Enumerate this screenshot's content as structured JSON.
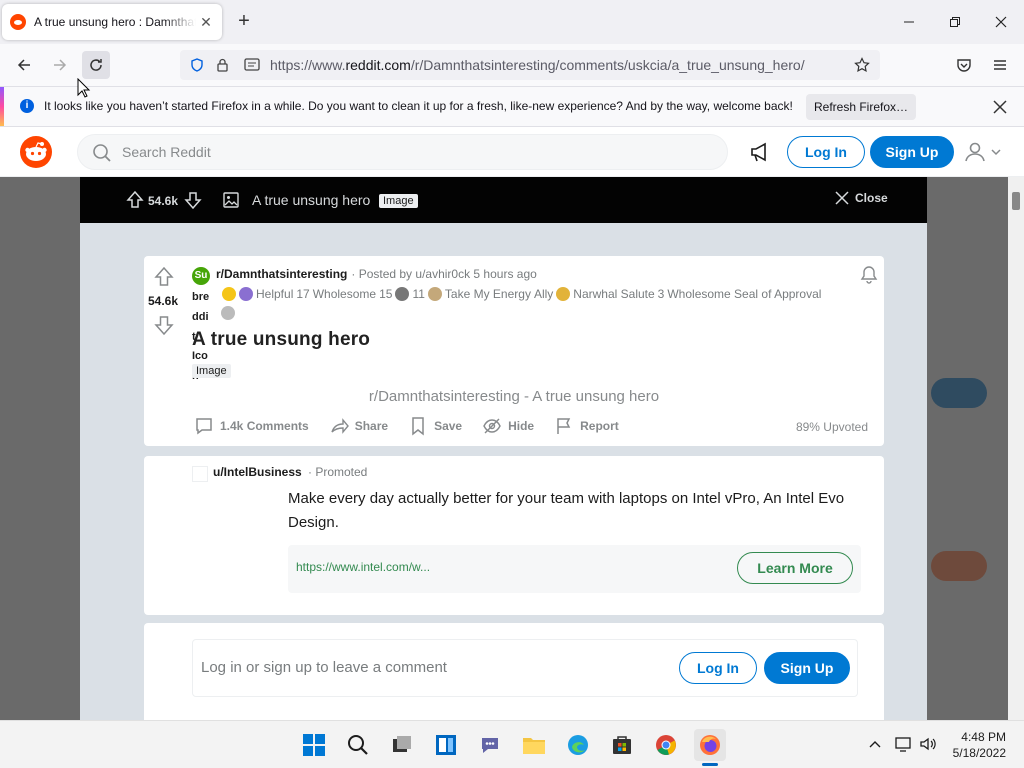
{
  "browser": {
    "tab_title": "A true unsung hero : Damnthatsinteresting",
    "url_prefix": "https://www.",
    "url_domain": "reddit.com",
    "url_path": "/r/Damnthatsinteresting/comments/uskcia/a_true_unsung_hero/"
  },
  "notice": {
    "message": "It looks like you haven’t started Firefox in a while. Do you want to clean it up for a fresh, like-new experience? And by the way, welcome back!",
    "button": "Refresh Firefox…"
  },
  "header": {
    "search_placeholder": "Search Reddit",
    "login": "Log In",
    "signup": "Sign Up"
  },
  "overlay": {
    "score": "54.6k",
    "title": "A true unsung hero",
    "flair": "Image",
    "close": "Close"
  },
  "post": {
    "sub_icon_text": "Su",
    "subreddit": "r/Damnthatsinteresting",
    "posted_by": "· Posted by u/avhir0ck 5 hours ago",
    "broken_icon_lines": [
      "bre",
      "ddi",
      "t",
      "Ico",
      "n"
    ],
    "awards": [
      {
        "label": "Helpful",
        "count": "17"
      },
      {
        "label": "Wholesome",
        "count": "15"
      },
      {
        "label": "",
        "count": "11"
      },
      {
        "label": "Take My Energy",
        "count": ""
      },
      {
        "label": "Ally",
        "count": ""
      },
      {
        "label": "Narwhal Salute",
        "count": "3"
      },
      {
        "label": "Wholesome Seal of Approval",
        "count": ""
      }
    ],
    "score": "54.6k",
    "title": "A true unsung hero",
    "flair": "Image",
    "caption": "r/Damnthatsinteresting - A true unsung hero",
    "comments": "1.4k Comments",
    "share": "Share",
    "save": "Save",
    "hide": "Hide",
    "report": "Report",
    "upvoted": "89% Upvoted"
  },
  "promo": {
    "user": "u/IntelBusiness",
    "promoted": "· Promoted",
    "body": "Make every day actually better for your team with laptops on Intel vPro, An Intel Evo Design.",
    "link": "https://www.intel.com/w...",
    "cta": "Learn More"
  },
  "comment": {
    "prompt": "Log in or sign up to leave a comment",
    "login": "Log In",
    "signup": "Sign Up"
  },
  "taskbar": {
    "time": "4:48 PM",
    "date": "5/18/2022"
  },
  "colors": {
    "reddit_orange": "#ff4500",
    "reddit_blue": "#0079d3",
    "promo_green": "#338a50"
  }
}
